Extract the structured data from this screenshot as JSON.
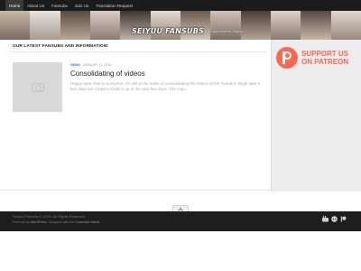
{
  "nav": {
    "items": [
      {
        "label": "Home",
        "active": true
      },
      {
        "label": "About Us",
        "active": false
      },
      {
        "label": "Fansubs",
        "active": false
      },
      {
        "label": "Join Us",
        "active": false
      },
      {
        "label": "Translation Request",
        "active": false
      }
    ]
  },
  "banner": {
    "logo_text": "SEIYUU FANSUBS",
    "tagline": "All you need is Seiyuu"
  },
  "main": {
    "section_title": "OUR LATEST FANSUBS AND INFORMATION!",
    "post": {
      "category": "NEWS",
      "date": "JANUARY 11, 2018",
      "title": "Consolidating of videos",
      "excerpt": "Happy New Year to everyone. I'm still in the midst of consolidating the videos at the moment. Might take a few days but I hope to finish it up in the next few days. The main..."
    }
  },
  "sidebar": {
    "patreon_line1": "SUPPORT US",
    "patreon_line2": "ON PATREON"
  },
  "footer": {
    "copyright": "Seiyuu Fansubs © 2018. All Rights Reserved.",
    "powered_prefix": "Powered by",
    "powered_name": "WordPress",
    "designed_prefix": ". Designed with the",
    "theme_name": "Customizr theme"
  },
  "colors": {
    "patreon": "#f96854",
    "nav_bg": "#1b1b1b",
    "footer_bg": "#1e1e1e",
    "sidebar_bg": "#ededed",
    "category": "#3a7cc2"
  },
  "icons": [
    "youtube-icon",
    "reddit-icon",
    "patreon-icon",
    "scroll-top-chevron-icon",
    "image-placeholder-icon"
  ]
}
